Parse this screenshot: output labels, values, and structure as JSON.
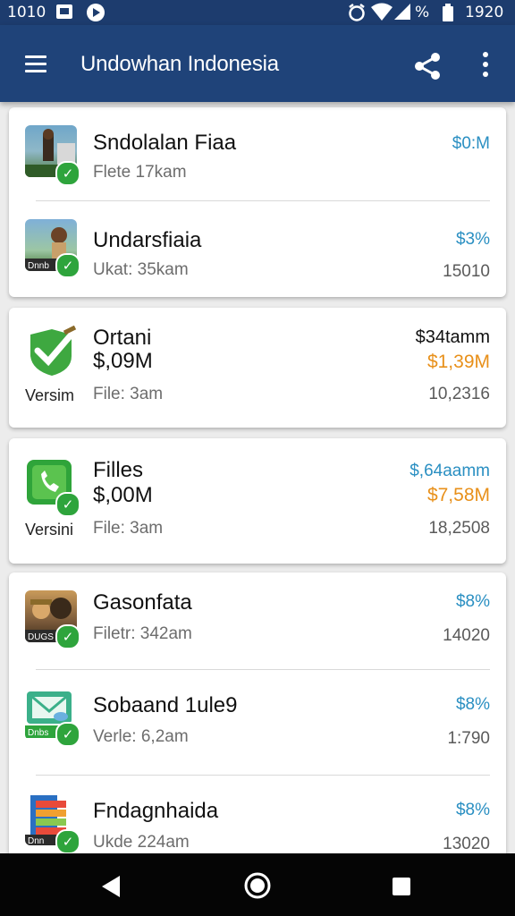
{
  "status_bar": {
    "time_left": "1010",
    "time_right": "1920",
    "battery": "%",
    "icons": [
      "image-icon",
      "media-icon",
      "alarm-icon",
      "wifi-icon",
      "signal-icon",
      "battery-icon"
    ]
  },
  "app_bar": {
    "title": "Undowhan Indonesia",
    "icons": [
      "menu-icon",
      "share-icon",
      "more-vert-icon"
    ]
  },
  "list": [
    {
      "name": "Sndolalan Fiaa",
      "sub": "Flete 17kam",
      "price": "$0:M",
      "meta": ""
    },
    {
      "name": "Undarsfiaia",
      "sub": "Ukat: 35kam",
      "price": "$3%",
      "meta": "15010"
    },
    {
      "name": "Ortani",
      "name2": "$,09M",
      "version": "Versim",
      "sub": "File: 3am",
      "price": "$34tamm",
      "price2": "$1,39M",
      "meta": "10,2316"
    },
    {
      "name": "Filles",
      "name2": "$,00M",
      "version": "Versini",
      "sub": "File: 3am",
      "price": "$,64aamm",
      "price2": "$7,58M",
      "meta": "18,2508"
    },
    {
      "name": "Gasonfata",
      "sub": "Filetr: 342am",
      "price": "$8%",
      "meta": "14020"
    },
    {
      "name": "Sobaand 1ule9",
      "sub": "Verle: 6,2am",
      "price": "$8%",
      "meta": "1:790"
    },
    {
      "name": "Fndagnhaida",
      "sub": "Ukde 224am",
      "price": "$8%",
      "meta": "13020"
    }
  ],
  "thumb_labels": [
    "Dnnb",
    "DUGS",
    "Dnbs",
    "Dnn"
  ],
  "colors": {
    "app_bar": "#1f4379",
    "status_bar": "#1d3c6e",
    "price_blue": "#2a8fc2",
    "price_orange": "#e8901a",
    "check_green": "#2ea43c"
  },
  "nav_bar": {
    "icons": [
      "back-icon",
      "home-icon",
      "recents-icon"
    ]
  }
}
